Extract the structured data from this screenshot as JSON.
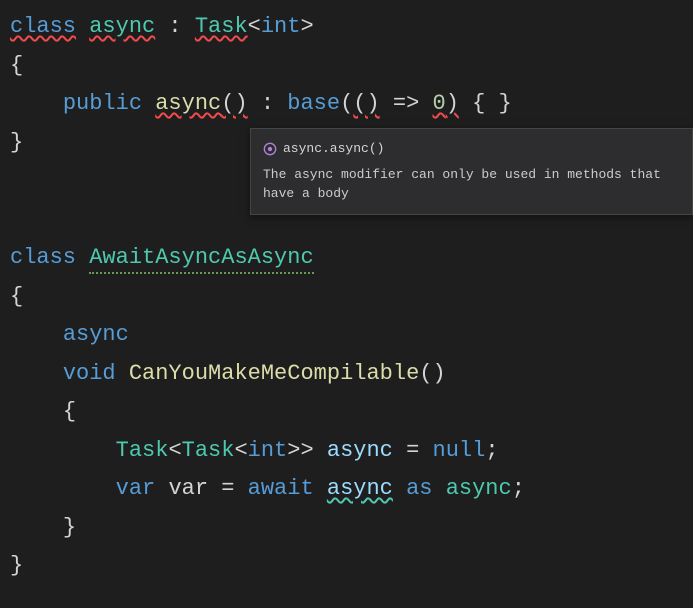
{
  "code": {
    "l1_class": "class",
    "l1_async": "async",
    "l1_colon": " : ",
    "l1_task": "Task",
    "l1_lt": "<",
    "l1_int": "int",
    "l1_gt": ">",
    "l2_brace": "{",
    "l3_indent": "    ",
    "l3_public": "public",
    "l3_async": "async",
    "l3_paren1": "()",
    "l3_colon": " : ",
    "l3_base": "base",
    "l3_lp": "(",
    "l3_lambda_open": "()",
    "l3_arrow": " => ",
    "l3_zero": "0",
    "l3_rp": ")",
    "l3_braces": " { }",
    "l4_brace": "}",
    "l7_class": "class",
    "l7_name": "AwaitAsyncAsAsync",
    "l8_brace": "{",
    "l9_indent": "    ",
    "l9_async": "async",
    "l10_indent": "    ",
    "l10_void": "void",
    "l10_method": "CanYouMakeMeCompilable",
    "l10_parens": "()",
    "l11_indent": "    ",
    "l11_brace": "{",
    "l12_indent": "        ",
    "l12_task": "Task",
    "l12_lt": "<",
    "l12_task2": "Task",
    "l12_lt2": "<",
    "l12_int": "int",
    "l12_gt2": ">>",
    "l12_asyncvar": "async",
    "l12_eq": " = ",
    "l12_null": "null",
    "l12_semi": ";",
    "l13_indent": "        ",
    "l13_var": "var",
    "l13_varname": "var",
    "l13_eq": " = ",
    "l13_await": "await",
    "l13_async1": "async",
    "l13_as": "as",
    "l13_async2": "async",
    "l13_semi": ";",
    "l14_indent": "    ",
    "l14_brace": "}",
    "l15_brace": "}"
  },
  "tooltip": {
    "signature": "async.async()",
    "message": "The async modifier can only be used in methods that have a body"
  }
}
